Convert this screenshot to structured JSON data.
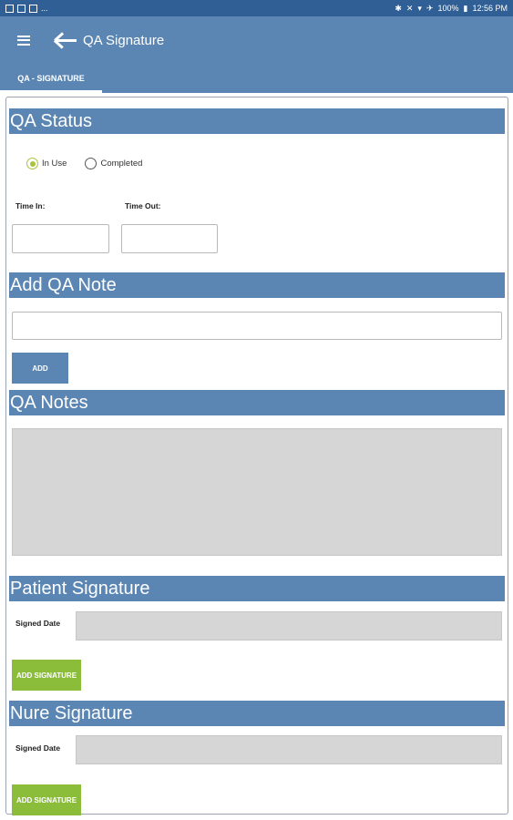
{
  "statusbar": {
    "left_text": "...",
    "battery": "100%",
    "time": "12:56 PM"
  },
  "appbar": {
    "title": "QA Signature",
    "menu_icon": "hamburger-menu-icon",
    "back_icon": "arrow-back-icon",
    "color": "#5b86b3"
  },
  "tabs": [
    {
      "label": "QA - SIGNATURE",
      "selected": true
    }
  ],
  "qa_status": {
    "header": "QA Status",
    "options": [
      {
        "label": "In Use",
        "checked": true
      },
      {
        "label": "Completed",
        "checked": false
      }
    ],
    "time_in_label": "Time In:",
    "time_out_label": "Time Out:",
    "time_in_value": "",
    "time_out_value": ""
  },
  "add_note": {
    "header": "Add QA Note",
    "input_value": "",
    "button_label": "ADD"
  },
  "qa_notes": {
    "header": "QA Notes"
  },
  "patient_signature": {
    "header": "Patient Signature",
    "signed_date_label": "Signed Date",
    "signed_date_value": "",
    "button_label": "ADD SIGNATURE"
  },
  "nurse_signature": {
    "header": "Nure Signature",
    "signed_date_label": "Signed Date",
    "signed_date_value": "",
    "button_label": "ADD SIGNATURE"
  },
  "colors": {
    "primary": "#5b86b3",
    "status_bar": "#2f5f94",
    "accent_green": "#8bbd3a",
    "radio_green": "#a8c43a"
  }
}
